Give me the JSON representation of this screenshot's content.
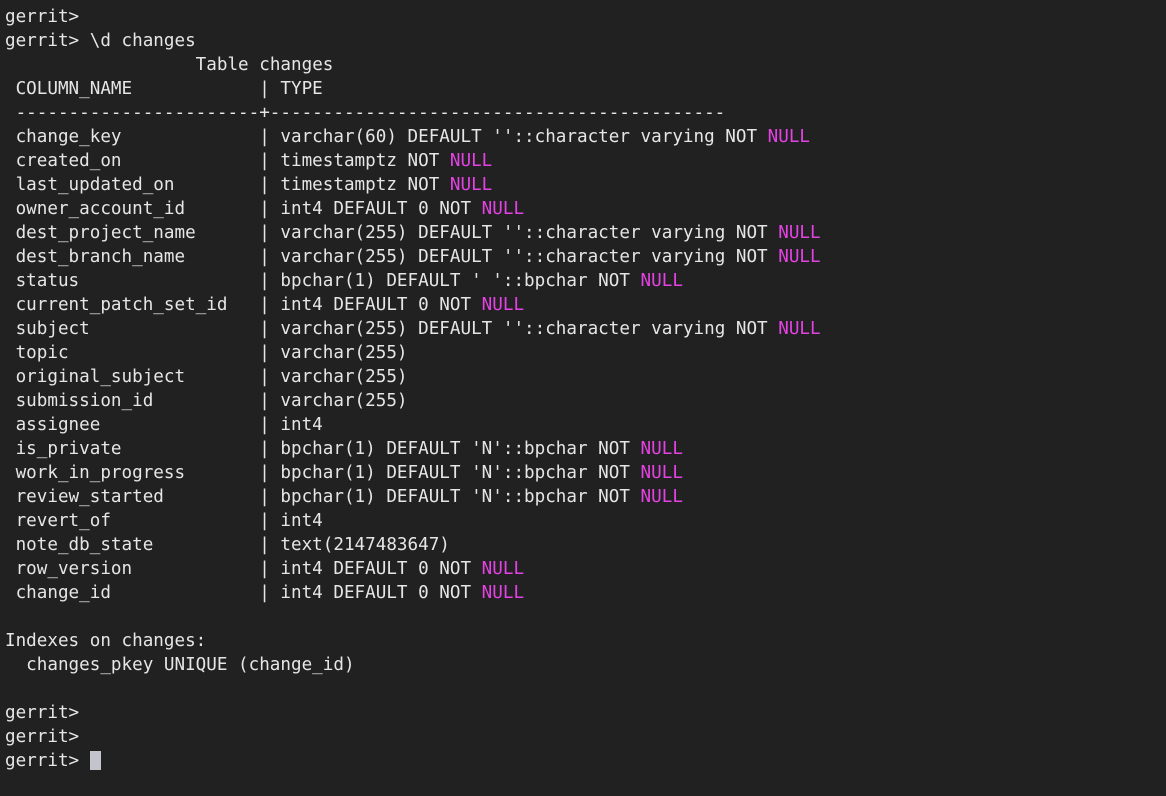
{
  "terminal": {
    "prompt": "gerrit>",
    "command_line": "gerrit> \\d changes",
    "table_title": "Table changes",
    "header_row": " COLUMN_NAME            | TYPE",
    "separator_row": " -----------------------+-------------------------------------------",
    "colors": {
      "background": "#212121",
      "foreground": "#e6e6e6",
      "null_keyword": "#e542e5",
      "cursor": "#c4c4cc"
    },
    "null_token": "NULL",
    "rows": [
      {
        "column": " change_key             | ",
        "type_pre": "varchar(60) DEFAULT ''::character varying NOT ",
        "type_post": ""
      },
      {
        "column": " created_on             | ",
        "type_pre": "timestamptz NOT ",
        "type_post": ""
      },
      {
        "column": " last_updated_on        | ",
        "type_pre": "timestamptz NOT ",
        "type_post": ""
      },
      {
        "column": " owner_account_id       | ",
        "type_pre": "int4 DEFAULT 0 NOT ",
        "type_post": ""
      },
      {
        "column": " dest_project_name      | ",
        "type_pre": "varchar(255) DEFAULT ''::character varying NOT ",
        "type_post": ""
      },
      {
        "column": " dest_branch_name       | ",
        "type_pre": "varchar(255) DEFAULT ''::character varying NOT ",
        "type_post": ""
      },
      {
        "column": " status                 | ",
        "type_pre": "bpchar(1) DEFAULT ' '::bpchar NOT ",
        "type_post": ""
      },
      {
        "column": " current_patch_set_id   | ",
        "type_pre": "int4 DEFAULT 0 NOT ",
        "type_post": ""
      },
      {
        "column": " subject                | ",
        "type_pre": "varchar(255) DEFAULT ''::character varying NOT ",
        "type_post": ""
      },
      {
        "column": " topic                  | ",
        "type_pre": "varchar(255)",
        "type_post": null
      },
      {
        "column": " original_subject       | ",
        "type_pre": "varchar(255)",
        "type_post": null
      },
      {
        "column": " submission_id          | ",
        "type_pre": "varchar(255)",
        "type_post": null
      },
      {
        "column": " assignee               | ",
        "type_pre": "int4",
        "type_post": null
      },
      {
        "column": " is_private             | ",
        "type_pre": "bpchar(1) DEFAULT 'N'::bpchar NOT ",
        "type_post": ""
      },
      {
        "column": " work_in_progress       | ",
        "type_pre": "bpchar(1) DEFAULT 'N'::bpchar NOT ",
        "type_post": ""
      },
      {
        "column": " review_started         | ",
        "type_pre": "bpchar(1) DEFAULT 'N'::bpchar NOT ",
        "type_post": ""
      },
      {
        "column": " revert_of              | ",
        "type_pre": "int4",
        "type_post": null
      },
      {
        "column": " note_db_state          | ",
        "type_pre": "text(2147483647)",
        "type_post": null
      },
      {
        "column": " row_version            | ",
        "type_pre": "int4 DEFAULT 0 NOT ",
        "type_post": ""
      },
      {
        "column": " change_id              | ",
        "type_pre": "int4 DEFAULT 0 NOT ",
        "type_post": ""
      }
    ],
    "indexes_heading": "Indexes on changes:",
    "indexes_entry": "  changes_pkey UNIQUE (change_id)",
    "trailing_prompts": [
      "gerrit>",
      "gerrit>"
    ],
    "active_prompt": "gerrit> "
  }
}
